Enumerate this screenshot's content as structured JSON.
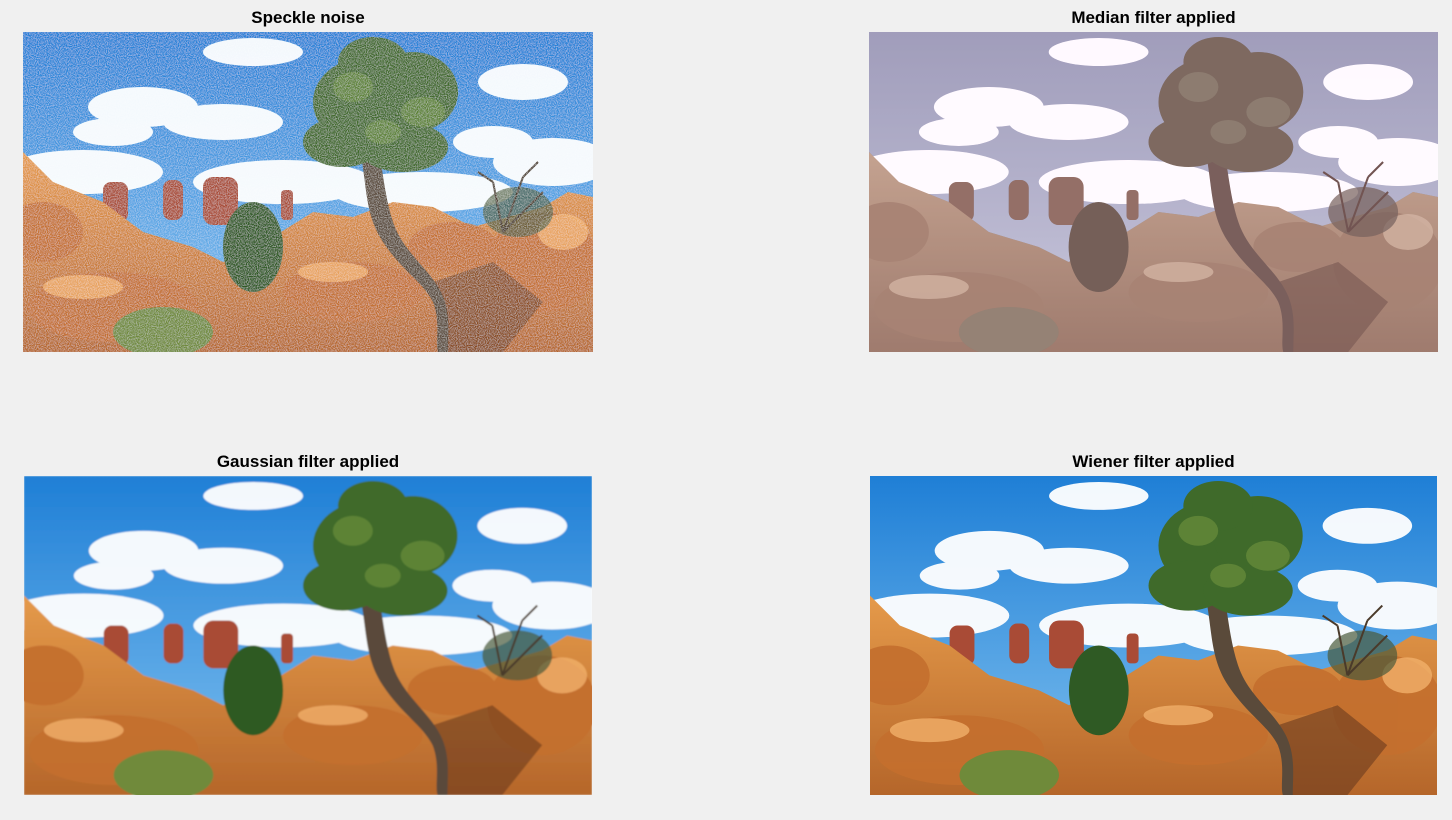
{
  "panels": [
    {
      "title": "Speckle noise",
      "filter": "speckle"
    },
    {
      "title": "Median filter applied",
      "filter": "median"
    },
    {
      "title": "Gaussian filter applied",
      "filter": "gaussian"
    },
    {
      "title": "Wiener filter applied",
      "filter": "wiener"
    }
  ],
  "colors": {
    "background": "#f0f0f0",
    "sky": "#2f8fdc",
    "sky_median": "#1aa39a",
    "rock": "#d88a3c",
    "rock_median": "#e27b86",
    "foliage": "#3f6a2a",
    "trunk": "#5a4a3a"
  }
}
